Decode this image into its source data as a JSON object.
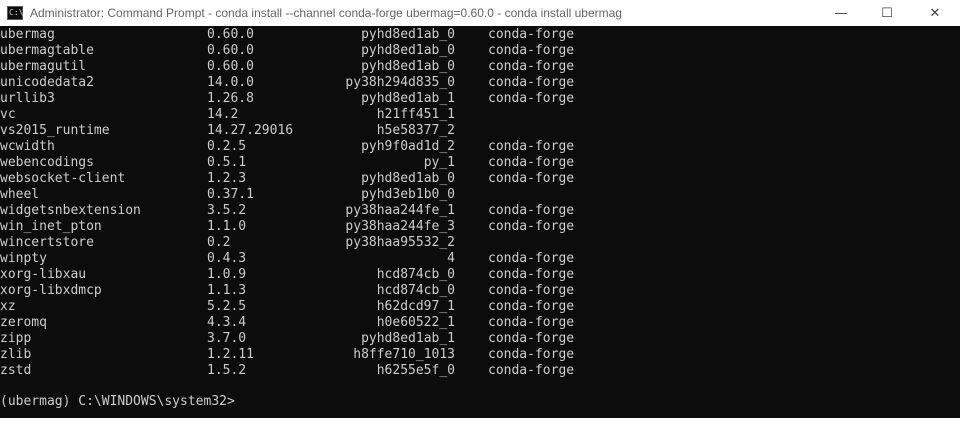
{
  "window": {
    "title": "Administrator: Command Prompt - conda  install --channel conda-forge ubermag=0.60.0 - conda  install ubermag",
    "app_icon_text": "C:\\",
    "minimize_glyph": "—",
    "maximize_glyph": "☐",
    "close_glyph": "✕"
  },
  "packages": [
    {
      "name": "ubermag",
      "version": "0.60.0",
      "build": "pyhd8ed1ab_0",
      "channel": "conda-forge"
    },
    {
      "name": "ubermagtable",
      "version": "0.60.0",
      "build": "pyhd8ed1ab_0",
      "channel": "conda-forge"
    },
    {
      "name": "ubermagutil",
      "version": "0.60.0",
      "build": "pyhd8ed1ab_0",
      "channel": "conda-forge"
    },
    {
      "name": "unicodedata2",
      "version": "14.0.0",
      "build": "py38h294d835_0",
      "channel": "conda-forge"
    },
    {
      "name": "urllib3",
      "version": "1.26.8",
      "build": "pyhd8ed1ab_1",
      "channel": "conda-forge"
    },
    {
      "name": "vc",
      "version": "14.2",
      "build": "h21ff451_1",
      "channel": ""
    },
    {
      "name": "vs2015_runtime",
      "version": "14.27.29016",
      "build": "h5e58377_2",
      "channel": ""
    },
    {
      "name": "wcwidth",
      "version": "0.2.5",
      "build": "pyh9f0ad1d_2",
      "channel": "conda-forge"
    },
    {
      "name": "webencodings",
      "version": "0.5.1",
      "build": "py_1",
      "channel": "conda-forge"
    },
    {
      "name": "websocket-client",
      "version": "1.2.3",
      "build": "pyhd8ed1ab_0",
      "channel": "conda-forge"
    },
    {
      "name": "wheel",
      "version": "0.37.1",
      "build": "pyhd3eb1b0_0",
      "channel": ""
    },
    {
      "name": "widgetsnbextension",
      "version": "3.5.2",
      "build": "py38haa244fe_1",
      "channel": "conda-forge"
    },
    {
      "name": "win_inet_pton",
      "version": "1.1.0",
      "build": "py38haa244fe_3",
      "channel": "conda-forge"
    },
    {
      "name": "wincertstore",
      "version": "0.2",
      "build": "py38haa95532_2",
      "channel": ""
    },
    {
      "name": "winpty",
      "version": "0.4.3",
      "build": "4",
      "channel": "conda-forge"
    },
    {
      "name": "xorg-libxau",
      "version": "1.0.9",
      "build": "hcd874cb_0",
      "channel": "conda-forge"
    },
    {
      "name": "xorg-libxdmcp",
      "version": "1.1.3",
      "build": "hcd874cb_0",
      "channel": "conda-forge"
    },
    {
      "name": "xz",
      "version": "5.2.5",
      "build": "h62dcd97_1",
      "channel": "conda-forge"
    },
    {
      "name": "zeromq",
      "version": "4.3.4",
      "build": "h0e60522_1",
      "channel": "conda-forge"
    },
    {
      "name": "zipp",
      "version": "3.7.0",
      "build": "pyhd8ed1ab_1",
      "channel": "conda-forge"
    },
    {
      "name": "zlib",
      "version": "1.2.11",
      "build": "h8ffe710_1013",
      "channel": "conda-forge"
    },
    {
      "name": "zstd",
      "version": "1.5.2",
      "build": "h6255e5f_0",
      "channel": "conda-forge"
    }
  ],
  "prompt": "(ubermag) C:\\WINDOWS\\system32>",
  "colors": {
    "console_bg": "#0c0c0c",
    "console_fg": "#cccccc",
    "titlebar_bg": "#ffffff"
  }
}
